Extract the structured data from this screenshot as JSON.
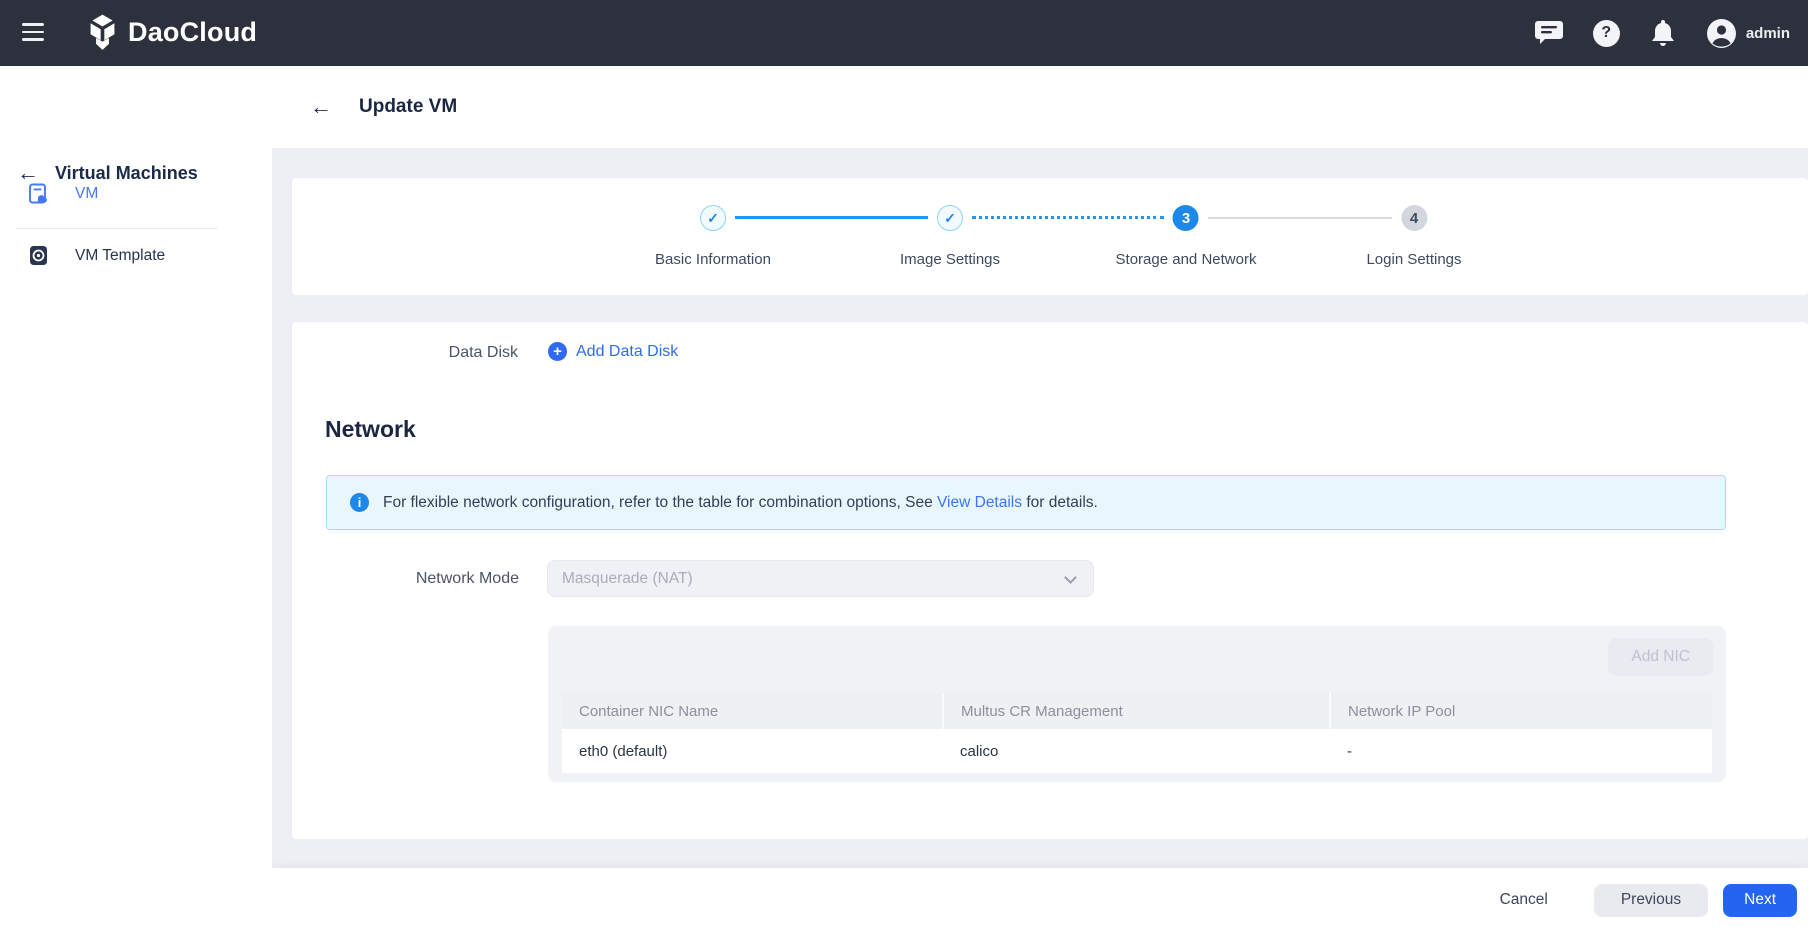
{
  "icons": {
    "back": "←",
    "check": "✓",
    "plus": "+",
    "info": "i",
    "help": "?"
  },
  "header": {
    "brand": "DaoCloud",
    "user": "admin"
  },
  "sidebar": {
    "title": "Virtual Machines",
    "items": [
      {
        "label": "VM"
      },
      {
        "label": "VM Template"
      }
    ]
  },
  "page": {
    "title": "Update VM"
  },
  "stepper": {
    "steps": [
      {
        "label": "Basic Information",
        "state": "done"
      },
      {
        "label": "Image Settings",
        "state": "done"
      },
      {
        "label": "Storage and Network",
        "state": "active",
        "number": "3"
      },
      {
        "label": "Login Settings",
        "state": "pending",
        "number": "4"
      }
    ]
  },
  "form": {
    "data_disk_label": "Data Disk",
    "add_data_disk_label": "Add Data Disk",
    "network_heading": "Network",
    "info_banner": {
      "text_before": "For flexible network configuration, refer to the table for combination options, See ",
      "link_text": "View Details",
      "text_after": " for details."
    },
    "network_mode_label": "Network Mode",
    "network_mode_value": "Masquerade (NAT)",
    "nic_table": {
      "add_nic_label": "Add NIC",
      "columns": [
        "Container NIC Name",
        "Multus CR Management",
        "Network IP Pool"
      ],
      "rows": [
        [
          "eth0 (default)",
          "calico",
          "-"
        ]
      ]
    }
  },
  "footer": {
    "cancel": "Cancel",
    "previous": "Previous",
    "next": "Next"
  },
  "colors": {
    "header_bg": "#2c313d",
    "accent_blue": "#2e6bf0",
    "stepper_blue": "#2196f3",
    "active_step_blue": "#1e88e8",
    "banner_bg": "#e8f6fe",
    "banner_border": "#a3def8",
    "main_bg": "#edeff4",
    "panel_gray": "#f1f2f6"
  }
}
